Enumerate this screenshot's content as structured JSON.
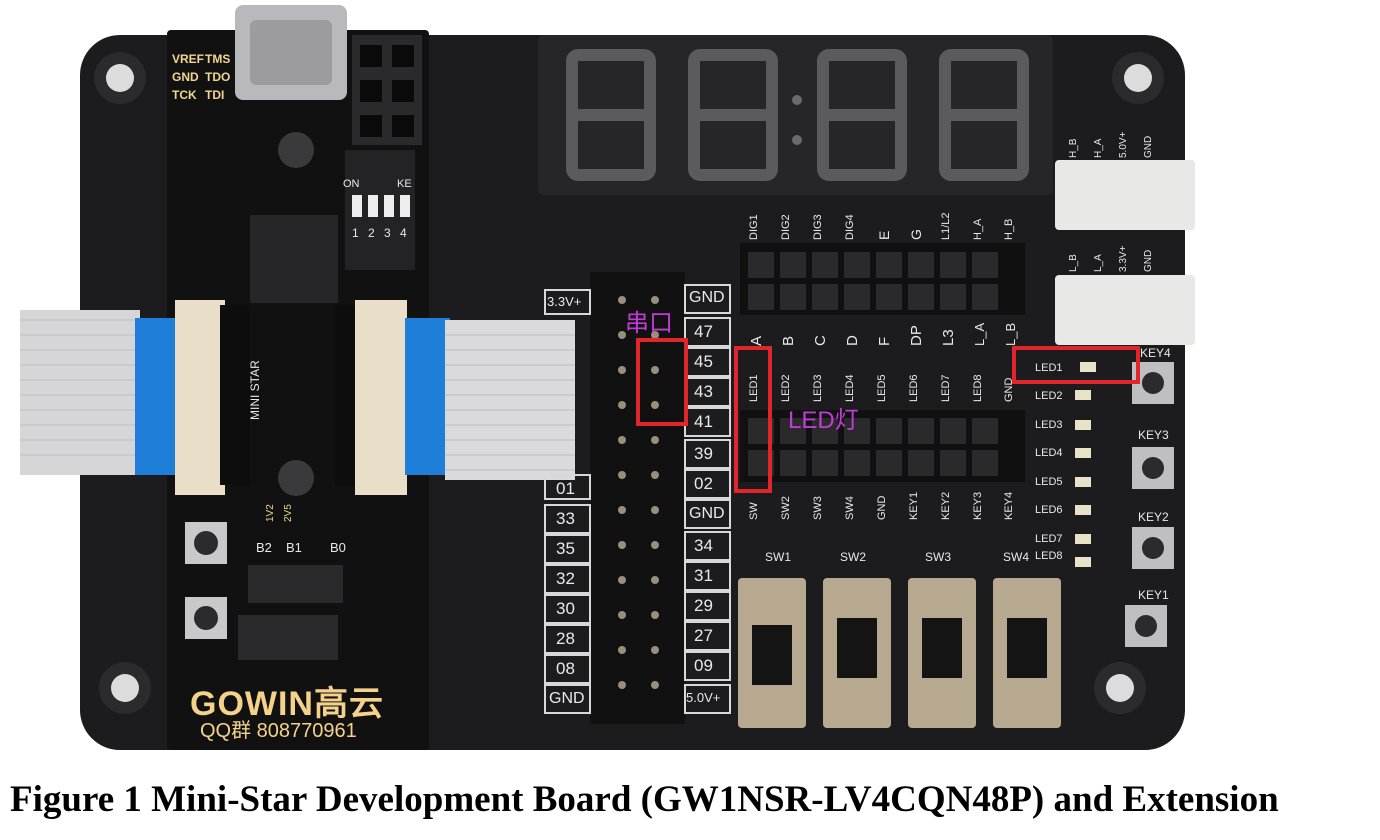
{
  "figure": {
    "caption": "Figure 1 Mini-Star Development Board (GW1NSR-LV4CQN48P) and Extension"
  },
  "core_board": {
    "brand": "GOWIN高云",
    "qq_group": "QQ群  808770961",
    "model": "MINI STAR",
    "jtag_labels": [
      "VREF",
      "TMS",
      "GND",
      "TDO",
      "TCK",
      "TDI"
    ],
    "dip_labels": {
      "on": "ON",
      "ke": "KE",
      "numbers": [
        "1",
        "2",
        "3",
        "4"
      ]
    },
    "bank_labels": [
      "B2",
      "B1",
      "B0"
    ],
    "side_labels": [
      "1V2",
      "2V5"
    ]
  },
  "extension_board": {
    "left_header_labels": [
      "3.3V+",
      "01",
      "33",
      "35",
      "32",
      "30",
      "28",
      "08",
      "GND"
    ],
    "right_header_labels": [
      "GND",
      "47",
      "45",
      "43",
      "41",
      "39",
      "02",
      "GND",
      "34",
      "31",
      "29",
      "27",
      "09",
      "5.0V+"
    ],
    "top_header_labels": [
      "DIG1",
      "DIG2",
      "DIG3",
      "DIG4",
      "E",
      "G",
      "L1/L2",
      "H_A",
      "H_B"
    ],
    "mid_header_labels": [
      "A",
      "B",
      "C",
      "D",
      "F",
      "DP",
      "L3",
      "L_A",
      "L_B"
    ],
    "led_row_labels": [
      "LED1",
      "LED2",
      "LED3",
      "LED4",
      "LED5",
      "LED6",
      "LED7",
      "LED8",
      "GND"
    ],
    "sw_row_labels": [
      "SW",
      "SW2",
      "SW3",
      "SW4",
      "GND",
      "KEY1",
      "KEY2",
      "KEY3",
      "KEY4"
    ],
    "switch_labels": [
      "SW1",
      "SW2",
      "SW3",
      "SW4"
    ],
    "right_led_labels": [
      "LED1",
      "LED2",
      "LED3",
      "LED4",
      "LED5",
      "LED6",
      "LED7",
      "LED8"
    ],
    "key_labels": [
      "KEY4",
      "KEY3",
      "KEY2",
      "KEY1"
    ],
    "connector_labels_top": [
      "H_B",
      "H_A",
      "5.0V+",
      "GND"
    ],
    "connector_labels_bottom": [
      "L_B",
      "L_A",
      "3.3V+",
      "GND"
    ]
  },
  "annotations": {
    "serial_label": "串口",
    "led_label": "LED灯",
    "color": "#e0262b",
    "text_color": "#c23bd6"
  },
  "seven_segment": {
    "digits": "88:88"
  }
}
